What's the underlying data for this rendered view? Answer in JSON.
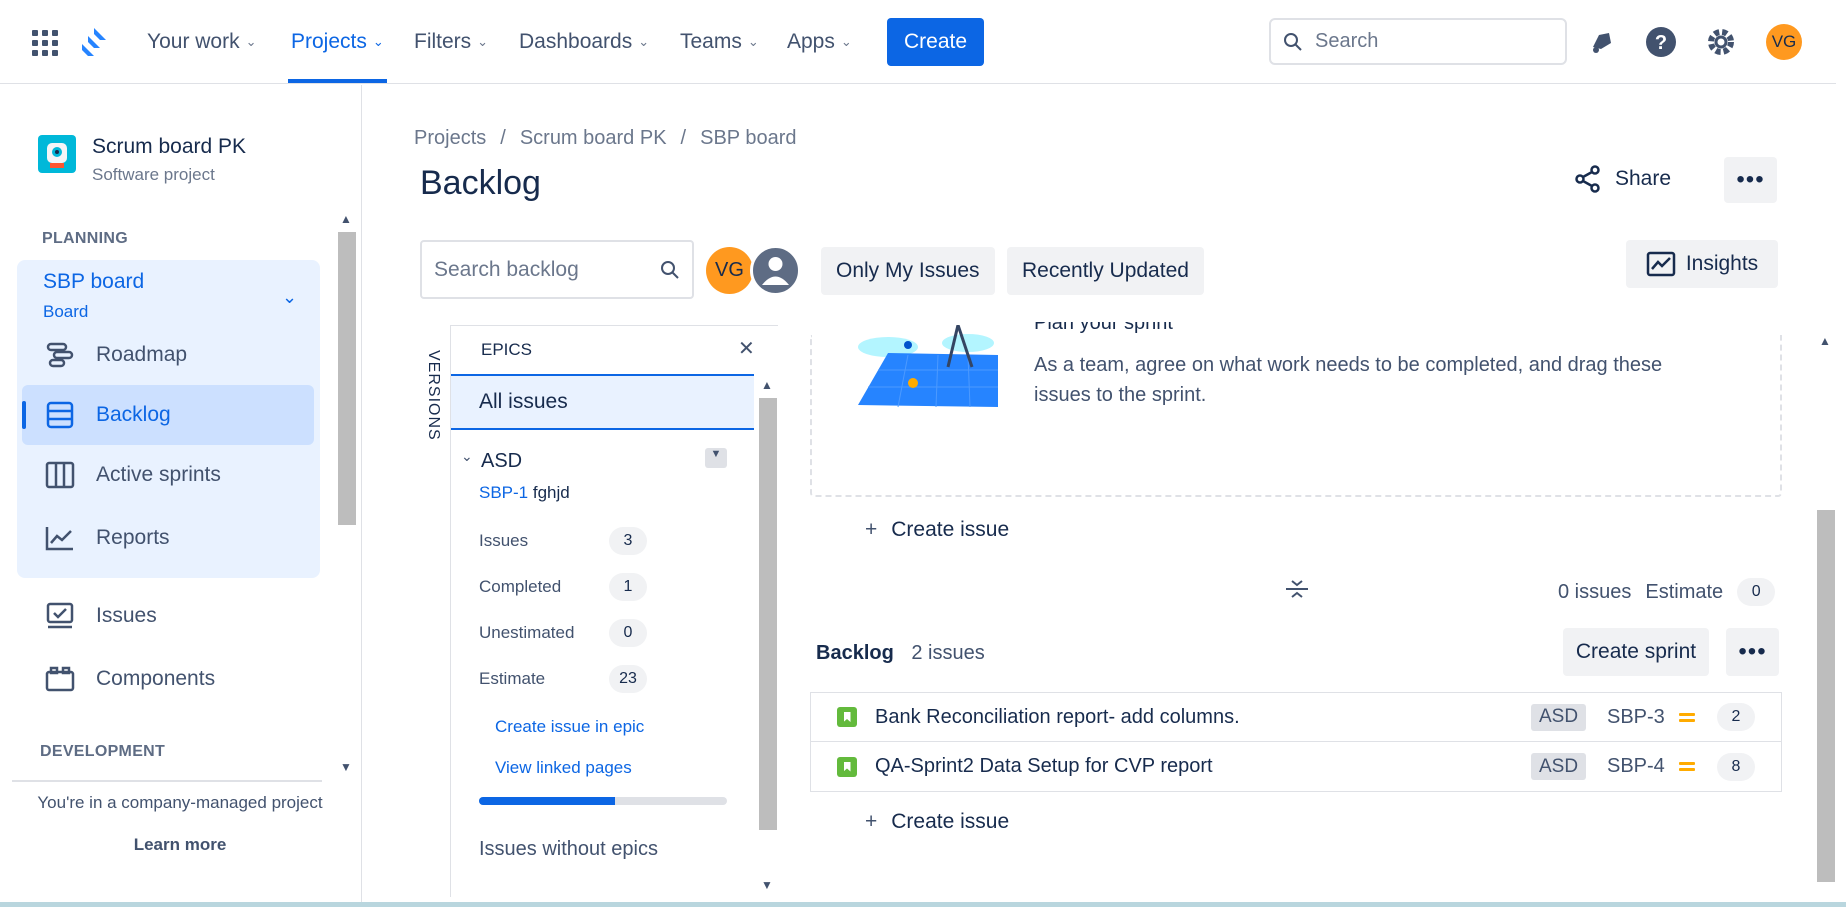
{
  "topbar": {
    "nav": [
      "Your work",
      "Projects",
      "Filters",
      "Dashboards",
      "Teams",
      "Apps"
    ],
    "create_label": "Create",
    "search_placeholder": "Search",
    "avatar_initials": "VG",
    "brand_color": "#0c66e4"
  },
  "sidebar": {
    "project_name": "Scrum board PK",
    "project_type": "Software project",
    "planning_heading": "PLANNING",
    "board_name": "SBP board",
    "board_type": "Board",
    "items": [
      "Roadmap",
      "Backlog",
      "Active sprints",
      "Reports",
      "Issues",
      "Components"
    ],
    "development_heading": "DEVELOPMENT",
    "footer_note": "You're in a company-managed project",
    "learn_more": "Learn more"
  },
  "main": {
    "breadcrumb": [
      "Projects",
      "/",
      "Scrum board PK",
      "/",
      "SBP board"
    ],
    "title": "Backlog",
    "share_label": "Share",
    "search_placeholder": "Search backlog",
    "avatar_initials": "VG",
    "filters": [
      "Only My Issues",
      "Recently Updated"
    ],
    "insights_label": "Insights"
  },
  "epics": {
    "versions_label": "VERSIONS",
    "heading": "EPICS",
    "all_issues": "All issues",
    "epic_name": "ASD",
    "epic_key": "SBP-1",
    "epic_summary": "fghjd",
    "stats": [
      {
        "label": "Issues",
        "value": "3"
      },
      {
        "label": "Completed",
        "value": "1"
      },
      {
        "label": "Unestimated",
        "value": "0"
      },
      {
        "label": "Estimate",
        "value": "23"
      }
    ],
    "create_in_epic": "Create issue in epic",
    "view_linked": "View linked pages",
    "progress": 0.55,
    "issues_without_epics": "Issues without epics"
  },
  "sprint": {
    "plan_heading": "Plan your sprint",
    "plan_text": "As a team, agree on what work needs to be completed, and drag these issues to the sprint.",
    "create_issue": "Create issue",
    "issues_count": "0 issues",
    "estimate_label": "Estimate",
    "estimate_value": "0"
  },
  "backlog": {
    "heading": "Backlog",
    "count": "2 issues",
    "create_sprint": "Create sprint",
    "create_issue": "Create issue",
    "issues": [
      {
        "summary": "Bank Reconciliation report- add columns.",
        "epic": "ASD",
        "key": "SBP-3",
        "estimate": "2"
      },
      {
        "summary": "QA-Sprint2 Data Setup for CVP report",
        "epic": "ASD",
        "key": "SBP-4",
        "estimate": "8"
      }
    ]
  }
}
